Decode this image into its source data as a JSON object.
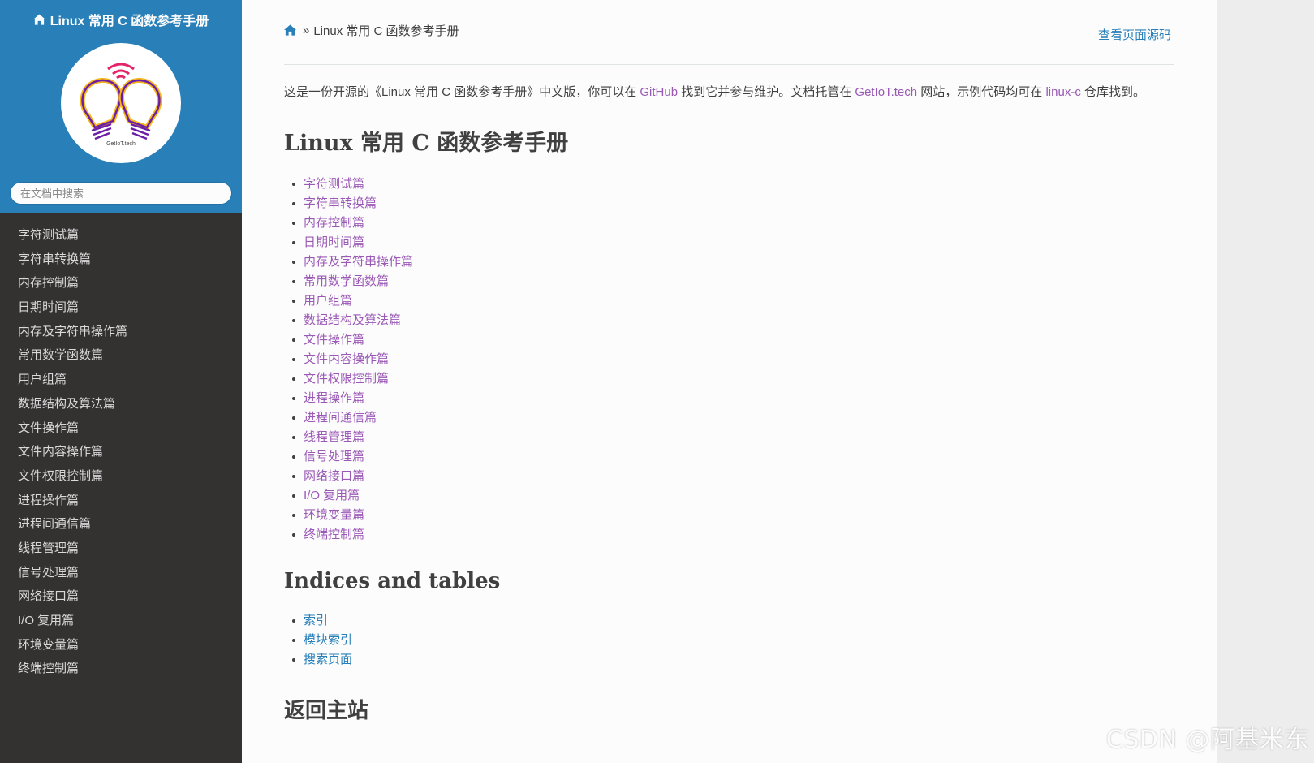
{
  "sidebar": {
    "project_title": "Linux 常用 C 函数参考手册",
    "logo_text": "GetIoT.tech",
    "search_placeholder": "在文档中搜索",
    "nav_items": [
      "字符测试篇",
      "字符串转换篇",
      "内存控制篇",
      "日期时间篇",
      "内存及字符串操作篇",
      "常用数学函数篇",
      "用户组篇",
      "数据结构及算法篇",
      "文件操作篇",
      "文件内容操作篇",
      "文件权限控制篇",
      "进程操作篇",
      "进程间通信篇",
      "线程管理篇",
      "信号处理篇",
      "网络接口篇",
      "I/O 复用篇",
      "环境变量篇",
      "终端控制篇"
    ]
  },
  "breadcrumb": {
    "separator": "»",
    "current": "Linux 常用 C 函数参考手册",
    "view_source": "查看页面源码"
  },
  "intro": {
    "part1": "这是一份开源的《Linux 常用 C 函数参考手册》中文版，你可以在 ",
    "link1": "GitHub",
    "part2": " 找到它并参与维护。文档托管在 ",
    "link2": "GetIoT.tech",
    "part3": " 网站，示例代码均可在 ",
    "link3": "linux-c",
    "part4": " 仓库找到。"
  },
  "main": {
    "title": "Linux 常用 C 函数参考手册",
    "toc": [
      "字符测试篇",
      "字符串转换篇",
      "内存控制篇",
      "日期时间篇",
      "内存及字符串操作篇",
      "常用数学函数篇",
      "用户组篇",
      "数据结构及算法篇",
      "文件操作篇",
      "文件内容操作篇",
      "文件权限控制篇",
      "进程操作篇",
      "进程间通信篇",
      "线程管理篇",
      "信号处理篇",
      "网络接口篇",
      "I/O 复用篇",
      "环境变量篇",
      "终端控制篇"
    ],
    "indices_title": "Indices and tables",
    "indices": [
      "索引",
      "模块索引",
      "搜索页面"
    ],
    "back_title": "返回主站"
  },
  "watermark": "CSDN @阿基米东",
  "colors": {
    "sidebar_top": "#2980b9",
    "sidebar_bg": "#343131",
    "link_visited": "#9b59b6",
    "link": "#2980b9"
  }
}
